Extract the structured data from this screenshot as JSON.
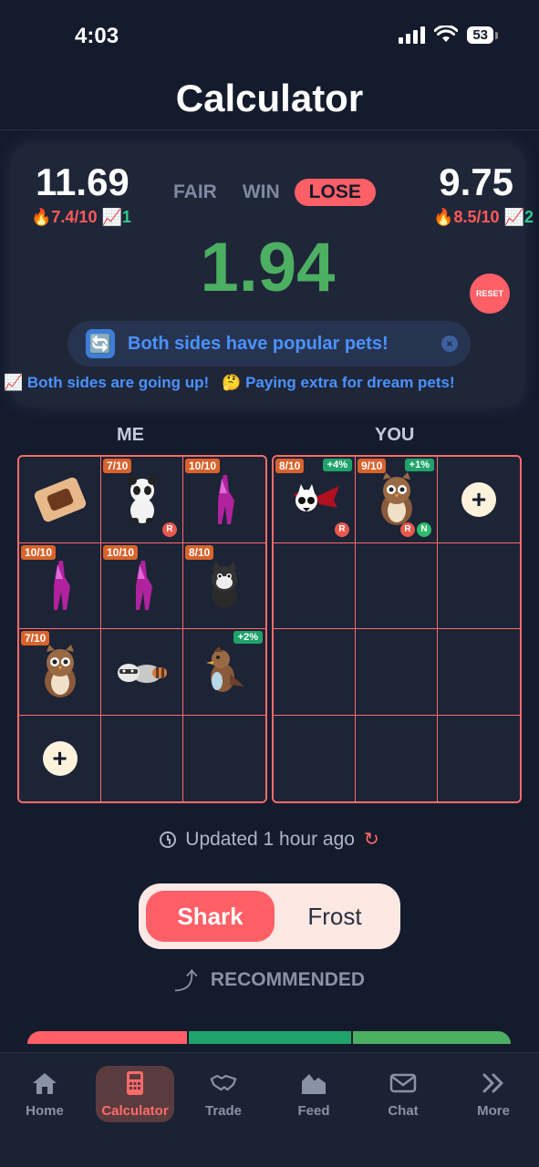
{
  "status_bar": {
    "time": "4:03",
    "battery": "53"
  },
  "page": {
    "title": "Calculator"
  },
  "score_card": {
    "left_value": "11.69",
    "left_rating": "🔥7.4/10",
    "left_trend_icon": "📈",
    "left_trend_count": "1",
    "right_value": "9.75",
    "right_rating": "🔥8.5/10",
    "right_trend_icon": "📈",
    "right_trend_count": "2",
    "verdicts": {
      "fair": "FAIR",
      "win": "WIN",
      "lose": "LOSE"
    },
    "selected_verdict": "LOSE",
    "difference": "1.94",
    "reset_label": "RESET",
    "popular_icon": "🔄",
    "popular_message": "Both sides have popular pets!",
    "insight_1": "📈 Both sides are going up!",
    "insight_2": "🤔 Paying extra for dream pets!"
  },
  "columns": {
    "me": "ME",
    "you": "YOU"
  },
  "me_grid": [
    {
      "pet": "toast",
      "rating": "",
      "trend": "",
      "flags": ""
    },
    {
      "pet": "panda",
      "rating": "7/10",
      "trend": "",
      "flags": "R"
    },
    {
      "pet": "unicorn",
      "rating": "10/10",
      "trend": "",
      "flags": ""
    },
    {
      "pet": "unicorn",
      "rating": "10/10",
      "trend": "",
      "flags": ""
    },
    {
      "pet": "unicorn",
      "rating": "10/10",
      "trend": "",
      "flags": ""
    },
    {
      "pet": "cat",
      "rating": "8/10",
      "trend": "",
      "flags": ""
    },
    {
      "pet": "owl",
      "rating": "7/10",
      "trend": "",
      "flags": ""
    },
    {
      "pet": "raccoon",
      "rating": "",
      "trend": "",
      "flags": ""
    },
    {
      "pet": "bird",
      "rating": "",
      "trend": "+2%",
      "flags": ""
    },
    {
      "pet": "add",
      "rating": "",
      "trend": "",
      "flags": ""
    },
    {
      "pet": "empty"
    },
    {
      "pet": "empty"
    }
  ],
  "you_grid": [
    {
      "pet": "bat",
      "rating": "8/10",
      "trend": "+4%",
      "flags": "R"
    },
    {
      "pet": "owl",
      "rating": "9/10",
      "trend": "+1%",
      "flags": "RN"
    },
    {
      "pet": "add"
    },
    {
      "pet": "empty"
    },
    {
      "pet": "empty"
    },
    {
      "pet": "empty"
    },
    {
      "pet": "empty"
    },
    {
      "pet": "empty"
    },
    {
      "pet": "empty"
    },
    {
      "pet": "empty"
    },
    {
      "pet": "empty"
    },
    {
      "pet": "empty"
    }
  ],
  "updated": {
    "text": "Updated 1 hour ago"
  },
  "mode": {
    "shark": "Shark",
    "frost": "Frost",
    "selected": "Shark"
  },
  "recommended": {
    "label": "RECOMMENDED"
  },
  "colors": {
    "accent": "#ff5f66",
    "green": "#4caf62",
    "blue": "#4a92ff",
    "background": "#141b2d"
  },
  "tabs": [
    {
      "label": "Home",
      "icon": "home-icon"
    },
    {
      "label": "Calculator",
      "icon": "calculator-icon",
      "active": true
    },
    {
      "label": "Trade",
      "icon": "handshake-icon"
    },
    {
      "label": "Feed",
      "icon": "houses-icon"
    },
    {
      "label": "Chat",
      "icon": "mail-icon"
    },
    {
      "label": "More",
      "icon": "double-chevron-icon"
    }
  ]
}
